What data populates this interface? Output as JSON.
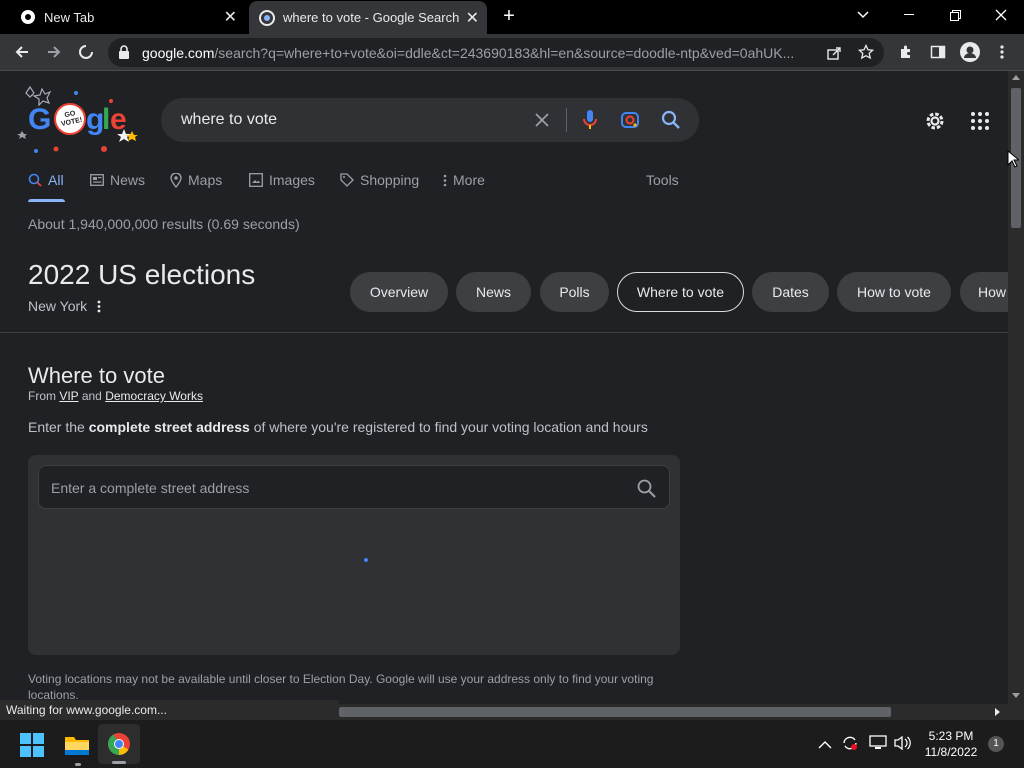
{
  "browser": {
    "tabs": [
      {
        "title": "New Tab",
        "active": false
      },
      {
        "title": "where to vote - Google Search",
        "active": true
      }
    ],
    "url_host": "google.com",
    "url_rest": "/search?q=where+to+vote&oi=ddle&ct=243690183&hl=en&source=doodle-ntp&ved=0ahUK...",
    "status": "Waiting for www.google.com..."
  },
  "search": {
    "query": "where to vote",
    "nav_tabs": [
      "All",
      "News",
      "Maps",
      "Images",
      "Shopping",
      "More"
    ],
    "tools_label": "Tools",
    "results_count": "About 1,940,000,000 results (0.69 seconds)",
    "logo_badge": "GO VOTE!"
  },
  "election": {
    "title": "2022 US elections",
    "location": "New York",
    "chips": [
      "Overview",
      "News",
      "Polls",
      "Where to vote",
      "Dates",
      "How to vote",
      "How"
    ],
    "selected_chip": "Where to vote"
  },
  "where_to_vote": {
    "heading": "Where to vote",
    "from_prefix": "From",
    "source1": "VIP",
    "and": "and",
    "source2": "Democracy Works",
    "intro_pre": "Enter the",
    "intro_bold": "complete street address",
    "intro_post": "of where you're registered to find your voting location and hours",
    "placeholder": "Enter a complete street address",
    "footnote": "Voting locations may not be available until closer to Election Day. Google will use your address only to find your voting locations."
  },
  "taskbar": {
    "time": "5:23 PM",
    "date": "11/8/2022",
    "notification_count": "1"
  },
  "colors": {
    "accent_blue": "#8ab4f8",
    "background": "#202124"
  }
}
